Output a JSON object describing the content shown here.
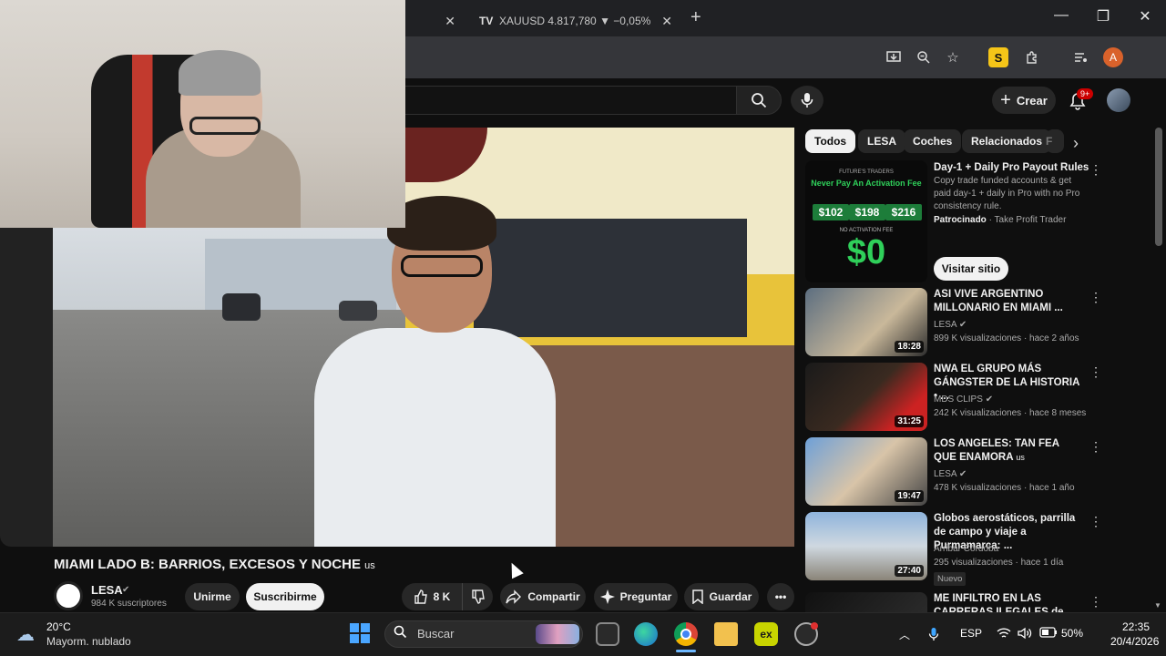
{
  "browser": {
    "tabs": [
      {
        "label": ""
      },
      {
        "favicon": "TV",
        "label": "XAUUSD 4.817,780 ▼ −0,05% S"
      }
    ],
    "new_tab_label": "+",
    "window": {
      "minimize": "—",
      "restore": "❐",
      "close": "✕"
    },
    "profile_initial": "A",
    "extension_label": "S"
  },
  "youtube": {
    "create_label": "Crear",
    "notifications_badge": "9+",
    "video": {
      "title": "MIAMI LADO B: BARRIOS, EXCESOS Y NOCHE",
      "title_suffix": "us",
      "channel": "LESA",
      "subscribers": "984 K suscriptores",
      "join_label": "Unirme",
      "subscribe_label": "Suscribirme",
      "likes": "8 K",
      "share_label": "Compartir",
      "ask_label": "Preguntar",
      "save_label": "Guardar"
    },
    "chips": [
      "Todos",
      "LESA",
      "Coches",
      "Relacionados",
      "F"
    ],
    "ad": {
      "thumb_top": "FUTURE'S TRADERS",
      "thumb_headline": "Never Pay An Activation Fee",
      "prices": [
        "$102",
        "$198",
        "$216"
      ],
      "thumb_noact": "NO ACTIVATION FEE",
      "thumb_big": "$0",
      "title": "Day-1 + Daily Pro Payout Rules",
      "description": "Copy trade funded accounts & get paid day-1 + daily in Pro with no Pro consistency rule.",
      "sponsored": "Patrocinado",
      "advertiser": "· Take Profit Trader",
      "cta": "Visitar sitio"
    },
    "recommendations": [
      {
        "title": "ASI VIVE ARGENTINO MILLONARIO EN MIAMI ...",
        "channel": "LESA",
        "verified": true,
        "meta": "899 K visualizaciones · hace 2 años",
        "duration": "18:28"
      },
      {
        "title": "NWA EL GRUPO MÁS GÁNGSTER DE LA HISTORIA • ...",
        "channel": "MDS CLIPS",
        "verified": true,
        "meta": "242 K visualizaciones · hace 8 meses",
        "duration": "31:25"
      },
      {
        "title": "LOS ANGELES: TAN FEA QUE ENAMORA",
        "title_suffix": "us",
        "channel": "LESA",
        "verified": true,
        "meta": "478 K visualizaciones · hace 1 año",
        "duration": "19:47"
      },
      {
        "title": "Globos aerostáticos, parrilla de campo y viaje a Purmamarca: ...",
        "channel": "Arribar Córdoba",
        "verified": false,
        "meta": "295 visualizaciones · hace 1 día",
        "duration": "27:40",
        "badge": "Nuevo"
      },
      {
        "title": "ME INFILTRO EN LAS CARRERAS ILEGALES de LIMA",
        "channel": "",
        "verified": false,
        "meta": "",
        "duration": ""
      }
    ]
  },
  "taskbar": {
    "weather_temp": "20°C",
    "weather_desc": "Mayorm. nublado",
    "search_label": "Buscar",
    "apps": {
      "ex": "ex"
    },
    "language": "ESP",
    "battery": "50%",
    "time": "22:35",
    "date": "20/4/2026"
  },
  "icons": [
    "search-icon",
    "mic-icon",
    "bell-icon",
    "like-icon",
    "dislike-icon",
    "share-icon",
    "sparkle-icon",
    "bookmark-icon",
    "more-icon",
    "kebab-icon",
    "chevron-right-icon",
    "windows-start-icon",
    "weather-icon",
    "wifi-icon",
    "volume-icon",
    "battery-icon"
  ]
}
